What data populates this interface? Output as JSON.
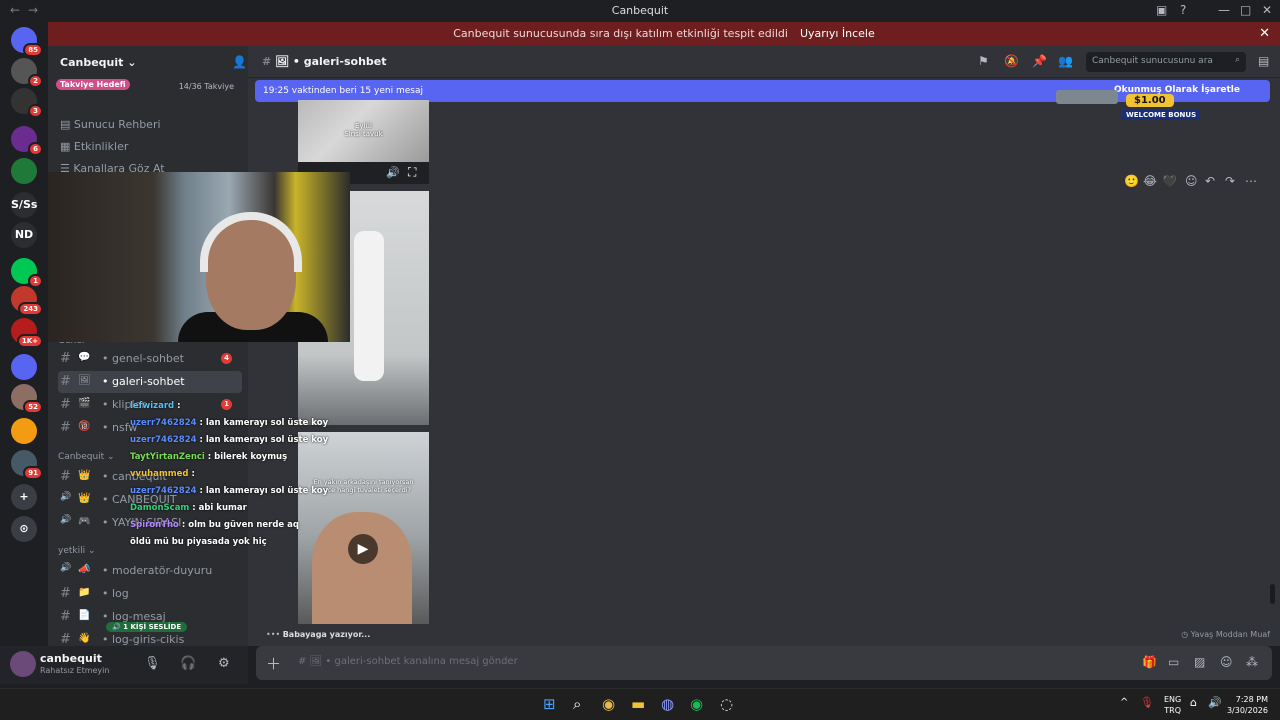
{
  "window": {
    "title": "Canbequit"
  },
  "notice": {
    "text": "Canbequit sunucusunda sıra dışı katılım etkinliği tespit edildi",
    "link": "Uyarıyı İncele"
  },
  "rail": {
    "servers": [
      {
        "label": "",
        "badge": "85"
      },
      {
        "label": "",
        "badge": "2"
      },
      {
        "label": "",
        "badge": "3"
      },
      {
        "label": "",
        "badge": "6"
      },
      {
        "label": "",
        "badge": ""
      },
      {
        "label": "S/Ss",
        "badge": ""
      },
      {
        "label": "ND",
        "badge": ""
      },
      {
        "label": "",
        "badge": "1"
      },
      {
        "label": "",
        "badge": "243"
      },
      {
        "label": "",
        "badge": "1K+"
      },
      {
        "label": "",
        "badge": ""
      },
      {
        "label": "",
        "badge": "52"
      },
      {
        "label": "",
        "badge": ""
      },
      {
        "label": "",
        "badge": "91"
      }
    ]
  },
  "sidebar": {
    "server_name": "Canbequit",
    "boost_goal": "Takviye Hedefi",
    "boost_progress": "14/36 Takviye",
    "items": [
      "Sunucu Rehberi",
      "Etkinlikler",
      "Kanallara Göz At"
    ],
    "category_general": "Genel",
    "channels": [
      {
        "name": "genel-sohbet",
        "emoji": "💬",
        "count": "4"
      },
      {
        "name": "galeri-sohbet",
        "emoji": "🖼",
        "count": ""
      },
      {
        "name": "klipler",
        "emoji": "🎬",
        "count": "1"
      },
      {
        "name": "nsfw",
        "emoji": "🔞",
        "count": ""
      }
    ],
    "category_canbequit": "Canbequit",
    "channels2": [
      {
        "name": "canbequit",
        "emoji": "👑"
      },
      {
        "name": "CANBEQUIT",
        "emoji": "👑"
      },
      {
        "name": "YAYIN SIRASI",
        "emoji": "🎮"
      }
    ],
    "category_yetkili": "yetkili",
    "channels3": [
      {
        "name": "moderatör-duyuru",
        "emoji": "📣"
      },
      {
        "name": "log",
        "emoji": "📁"
      },
      {
        "name": "log-mesaj",
        "emoji": "📄"
      },
      {
        "name": "log-giris-cikis",
        "emoji": "👋"
      }
    ],
    "voice_badge": "1 KİŞİ SESLİDE"
  },
  "user": {
    "name": "canbequit",
    "status": "Rahatsız Etmeyin"
  },
  "header": {
    "channel": "galeri-sohbet",
    "search_placeholder": "Canbequit sunucusunu ara"
  },
  "main": {
    "new_messages": "19:25 vaktinden beri 15 yeni mesaj",
    "media1_caption": "Eylül\nSinsi tavuk",
    "media3_caption": "En yakın arkadaşını tanıyorsan sence hangi tuvaleti seçerdi?",
    "typing": "Babayaga yazıyor...",
    "slowmode": "Yavaş Moddan Muaf",
    "ad_bonus": "$1.00",
    "ad_text": "WELCOME BONUS",
    "ad_header": "Okunmuş Olarak İşaretle"
  },
  "composer": {
    "placeholder": "galeri-sohbet kanalına mesaj gönder"
  },
  "chat": [
    {
      "user": "lefwizard",
      "color": "#4fc3f7",
      "msg": ""
    },
    {
      "user": "uzerr7462824",
      "color": "#5b8cff",
      "msg": "lan kamerayı sol üste koy"
    },
    {
      "user": "uzerr7462824",
      "color": "#5b8cff",
      "msg": "lan kamerayı sol üste koy"
    },
    {
      "user": "TaytYirtanZenci",
      "color": "#7cd957",
      "msg": "bilerek koymuş"
    },
    {
      "user": "vvuhammed",
      "color": "#f1c232",
      "msg": ""
    },
    {
      "user": "uzerr7462824",
      "color": "#5b8cff",
      "msg": "lan kamerayı sol üste koy"
    },
    {
      "user": "DamonScam",
      "color": "#33d17a",
      "msg": "abi kumar"
    },
    {
      "user": "SpironTho",
      "color": "#b388ff",
      "msg": "olm bu güven nerde aq öldü mü bu piyasada yok hiç"
    }
  ],
  "taskbar": {
    "lang1": "ENG",
    "lang2": "TRQ",
    "time": "7:28 PM",
    "date": "3/30/2026"
  }
}
